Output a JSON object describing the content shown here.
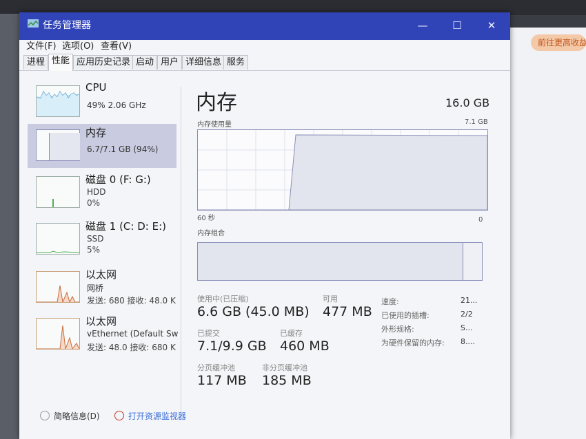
{
  "window": {
    "title": "任务管理器",
    "controls": {
      "minimize": "—",
      "maximize": "☐",
      "close": "✕"
    }
  },
  "menu": [
    "文件(F)",
    "选项(O)",
    "查看(V)"
  ],
  "tabs": [
    "进程",
    "性能",
    "应用历史记录",
    "启动",
    "用户",
    "详细信息",
    "服务"
  ],
  "sidebar": [
    {
      "name": "CPU",
      "sub": "49% 2.06 GHz"
    },
    {
      "name": "内存",
      "sub": "6.7/7.1 GB (94%)"
    },
    {
      "name": "磁盘 0 (F: G:)",
      "sub": "HDD",
      "sub2": "0%"
    },
    {
      "name": "磁盘 1 (C: D: E:)",
      "sub": "SSD",
      "sub2": "5%"
    },
    {
      "name": "以太网",
      "sub": "网桥",
      "sub2": "发送: 680 接收: 48.0 K"
    },
    {
      "name": "以太网",
      "sub": "vEthernet (Default Sw",
      "sub2": "发送: 48.0 接收: 680 K"
    }
  ],
  "main": {
    "title": "内存",
    "total": "16.0 GB",
    "usage_label": "内存使用量",
    "usage_max": "7.1 GB",
    "axis_left": "60 秒",
    "axis_right": "0",
    "composition_label": "内存组合"
  },
  "stats": {
    "in_use_label": "使用中(已压缩)",
    "in_use_value": "6.6 GB (45.0 MB)",
    "available_label": "可用",
    "available_value": "477 MB",
    "committed_label": "已提交",
    "committed_value": "7.1/9.9 GB",
    "cached_label": "已缓存",
    "cached_value": "460 MB",
    "paged_label": "分页缓冲池",
    "paged_value": "117 MB",
    "nonpaged_label": "非分页缓冲池",
    "nonpaged_value": "185 MB"
  },
  "right_stats": [
    {
      "label": "速度:",
      "value": "21..."
    },
    {
      "label": "已使用的插槽:",
      "value": "2/2"
    },
    {
      "label": "外形规格:",
      "value": "S..."
    },
    {
      "label": "为硬件保留的内存:",
      "value": "8...."
    }
  ],
  "footer": {
    "brief": "简略信息(D)",
    "open_monitor": "打开资源监视器"
  },
  "background": {
    "button_text": "前往更高收益"
  },
  "colors": {
    "titlebar": "#3044b8",
    "selected": "#c9cce0",
    "mem_graph": "#8a8fb8",
    "link": "#3a6fd8"
  },
  "memory_usage_percent": 94
}
